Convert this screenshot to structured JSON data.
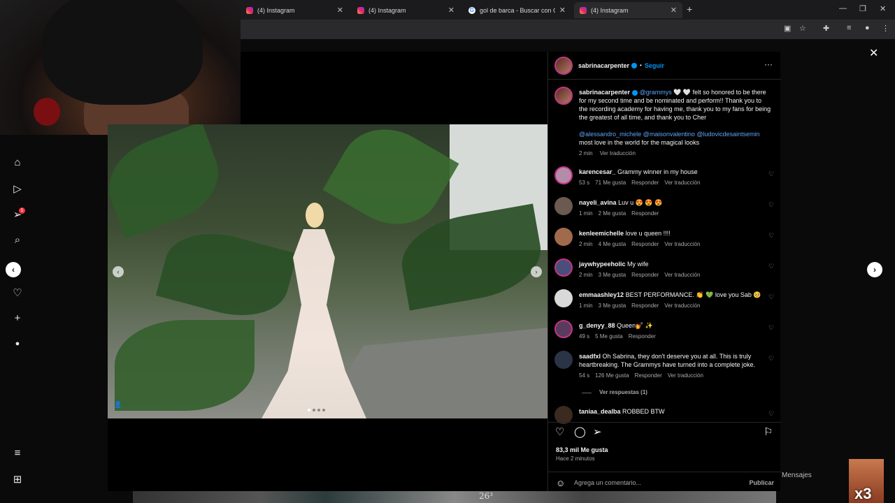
{
  "browser": {
    "tabs": [
      {
        "title": "(4) Instagram",
        "icon": "instagram-icon"
      },
      {
        "title": "(4) Instagram",
        "icon": "instagram-icon"
      },
      {
        "title": "gol de barca - Buscar con Goog",
        "icon": "google-icon"
      },
      {
        "title": "(4) Instagram",
        "icon": "instagram-icon"
      }
    ],
    "new_tab": "+",
    "close_glyph": "✕",
    "minimize_glyph": "—",
    "restore_glyph": "❐",
    "window_close_glyph": "✕"
  },
  "sidebar": {
    "notification_badge": "5"
  },
  "post": {
    "author": "sabrinacarpenter",
    "follow_label": "Seguir",
    "dot_sep": "•",
    "more_glyph": "···",
    "caption_mention": "@grammys",
    "caption_text": " 🤍 🤍 felt so honored to be there for my second time and be nominated and perform!! Thank you to the recording academy for having me, thank you to my fans for being the greatest of all time, and thank you to Cher",
    "caption_mentions2": "@alessandro_michele @maisonvalentino @ludovicdesaintsemin",
    "caption_tail": "most love in the world for the magical looks",
    "caption_time": "2 min",
    "caption_translate": "Ver traducción",
    "likes": "83,3 mil Me gusta",
    "posted_ago": "Hace 2 minutos",
    "comment_placeholder": "Agrega un comentario...",
    "publish_label": "Publicar",
    "view_replies": "Ver respuestas (1)"
  },
  "comments": [
    {
      "user": "karencesar_",
      "text": "Grammy winner in my house",
      "time": "53 s",
      "likes": "71 Me gusta",
      "reply": "Responder",
      "translate": "Ver traducción",
      "avatar_color": "#b58ca8"
    },
    {
      "user": "nayeli_avina",
      "text": "Luv u 😍 😍 😍",
      "time": "1 min",
      "likes": "2 Me gusta",
      "reply": "Responder",
      "translate": "",
      "avatar_color": "#6a5a50"
    },
    {
      "user": "kenleemichelle",
      "text": "love u queen !!!!",
      "time": "2 min",
      "likes": "4 Me gusta",
      "reply": "Responder",
      "translate": "Ver traducción",
      "avatar_color": "#a06a4c"
    },
    {
      "user": "jaywhypeeholic",
      "text": "My wife",
      "time": "2 min",
      "likes": "3 Me gusta",
      "reply": "Responder",
      "translate": "Ver traducción",
      "avatar_color": "#4b4e7a"
    },
    {
      "user": "emmaashley12",
      "text": "BEST PERFORMANCE. 👏 💚 love you Sab 🥺",
      "time": "1 min",
      "likes": "3 Me gusta",
      "reply": "Responder",
      "translate": "Ver traducción",
      "avatar_color": "#d9d9d9"
    },
    {
      "user": "g_denyy_88",
      "text": "Queen💅 ✨",
      "time": "49 s",
      "likes": "5 Me gusta",
      "reply": "Responder",
      "translate": "",
      "avatar_color": "#5a3b5e"
    },
    {
      "user": "saadfxl",
      "text": "Oh Sabrina, they don't deserve you at all. This is truly heartbreaking. The Grammys have turned into a complete joke.",
      "time": "54 s",
      "likes": "126 Me gusta",
      "reply": "Responder",
      "translate": "Ver traducción",
      "avatar_color": "#2b3346"
    },
    {
      "user": "taniaa_dealba",
      "text": "ROBBED BTW",
      "time": "",
      "likes": "",
      "reply": "",
      "translate": "",
      "avatar_color": "#3a2a20"
    }
  ],
  "footer": {
    "messages_label": "Mensajes",
    "streamer_label": "x3",
    "grid_text": "26³"
  },
  "colors": {
    "accent": "#0095f6",
    "link": "#5ea4f7",
    "story_ring": "#c13584"
  }
}
